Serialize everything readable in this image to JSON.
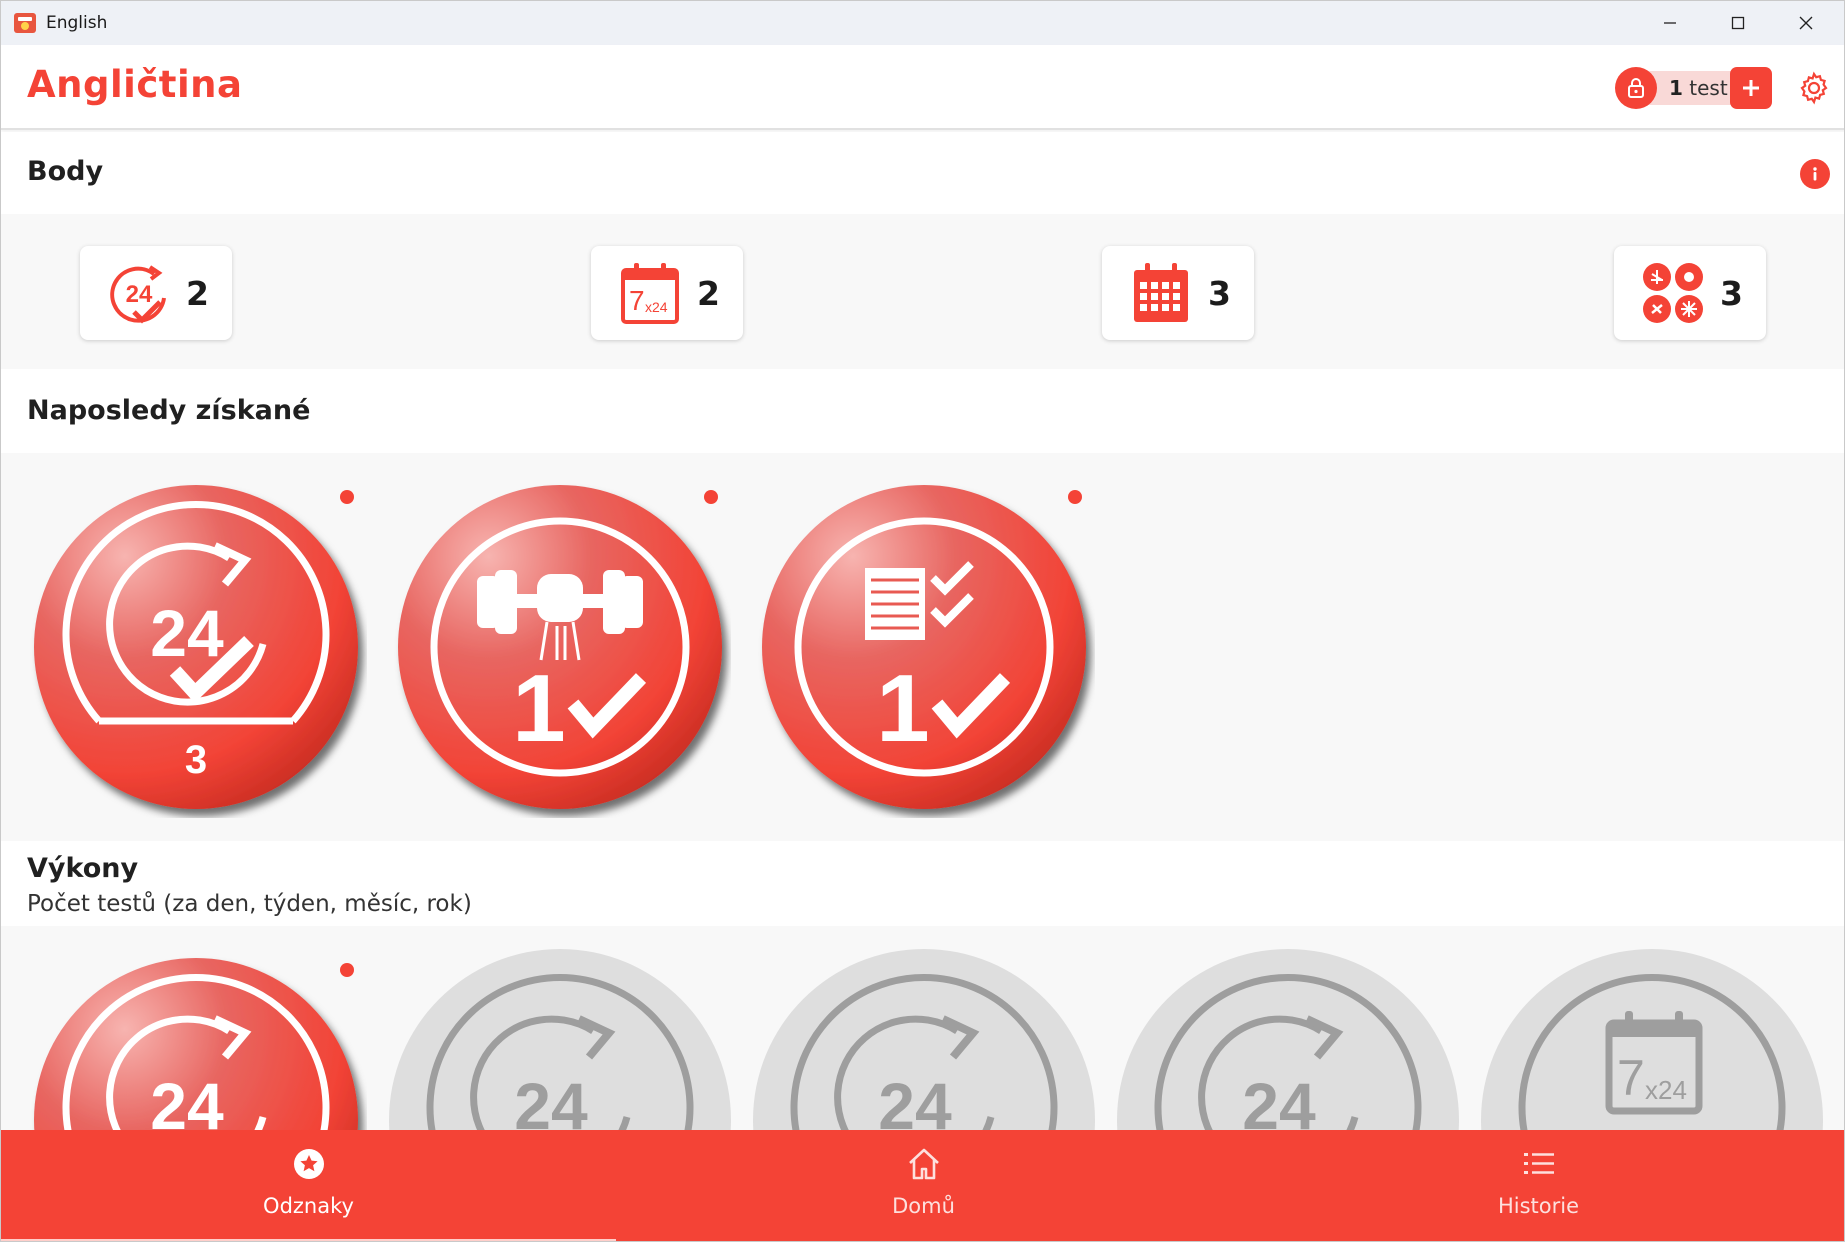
{
  "window": {
    "title": "English",
    "app_icon": "app-icon",
    "controls": [
      "minimize-icon",
      "maximize-icon",
      "close-icon"
    ]
  },
  "header": {
    "title": "Angličtina",
    "tests_count": "1",
    "tests_label": "test",
    "lock_icon": "lock-icon",
    "add_icon": "plus-icon",
    "settings_icon": "gear-icon"
  },
  "points": {
    "title": "Body",
    "info_icon": "info-icon",
    "items": [
      {
        "icon": "24h-icon",
        "value": "2"
      },
      {
        "icon": "7x24-calendar-icon",
        "value": "2"
      },
      {
        "icon": "month-calendar-icon",
        "value": "3"
      },
      {
        "icon": "seasons-icon",
        "value": "3"
      }
    ],
    "icon_text": {
      "day": "24",
      "week_main": "7",
      "week_sub": "x24"
    }
  },
  "recent": {
    "title": "Naposledy získané",
    "badges": [
      {
        "type": "24h",
        "big": "24",
        "level": "3",
        "new": true
      },
      {
        "type": "strength",
        "big": "1",
        "new": true
      },
      {
        "type": "checklist",
        "big": "1",
        "new": true
      }
    ]
  },
  "performance": {
    "title": "Výkony",
    "subtitle": "Počet testů (za den, týden, měsíc, rok)",
    "badges": [
      {
        "type": "24h",
        "big": "24",
        "earned": true,
        "new": true
      },
      {
        "type": "24h",
        "big": "24",
        "earned": false
      },
      {
        "type": "24h",
        "big": "24",
        "earned": false
      },
      {
        "type": "24h",
        "big": "24",
        "earned": false
      },
      {
        "type": "7x24",
        "big": "7",
        "small": "x24",
        "earned": false
      }
    ]
  },
  "nav": {
    "items": [
      {
        "label": "Odznaky",
        "icon": "star-badge-icon",
        "active": true
      },
      {
        "label": "Domů",
        "icon": "home-icon",
        "active": false
      },
      {
        "label": "Historie",
        "icon": "list-icon",
        "active": false
      }
    ]
  },
  "colors": {
    "accent": "#f44336",
    "pill_bg": "#f9d9d7",
    "band_bg": "#f8f8f8",
    "badge_inactive": "#dedede"
  }
}
